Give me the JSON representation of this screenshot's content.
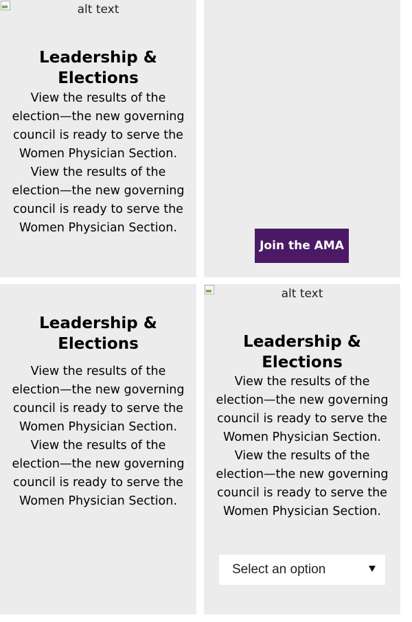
{
  "cards": [
    {
      "image_alt": "alt text",
      "title": "Leadership & Elections",
      "body": "View the results of the election—the new governing council is ready to serve the Women Physician Section. View the results of the election—the new governing council is ready to serve the Women Physician Section."
    },
    {
      "button_label": "Join the AMA"
    },
    {
      "title": "Leadership & Elections",
      "body": "View the results of the election—the new governing council is ready to serve the Women Physician Section. View the results of the election—the new governing council is ready to serve the Women Physician Section."
    },
    {
      "image_alt": "alt text",
      "title": "Leadership & Elections",
      "body": "View the results of the election—the new governing council is ready to serve the Women Physician Section. View the results of the election—the new governing council is ready to serve the Women Physician Section.",
      "select": {
        "selected": "Select an option"
      }
    }
  ],
  "icons": {
    "broken_image": "broken-image-icon",
    "dropdown": "chevron-down-icon"
  },
  "colors": {
    "card_bg": "#ececec",
    "button_bg": "#4b1a66",
    "button_text": "#ffffff"
  }
}
